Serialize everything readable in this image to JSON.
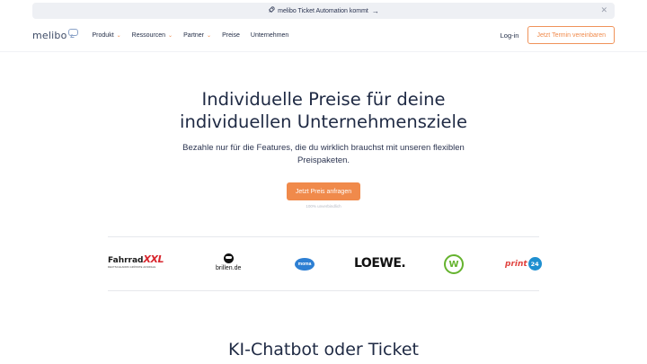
{
  "banner": {
    "icon": "rocket-icon",
    "text": "melibo Ticket Automation kommt",
    "arrow": "→",
    "close": "✕"
  },
  "nav": {
    "logo_text": "melibo",
    "menu": [
      {
        "label": "Produkt",
        "dropdown": true
      },
      {
        "label": "Ressourcen",
        "dropdown": true
      },
      {
        "label": "Partner",
        "dropdown": true
      },
      {
        "label": "Preise",
        "dropdown": false
      },
      {
        "label": "Unternehmen",
        "dropdown": false
      }
    ],
    "chevron": "⌄",
    "login": "Log-in",
    "cta": "Jetzt Termin vereinbaren"
  },
  "hero": {
    "title_line1": "Individuelle Preise für deine",
    "title_line2": "individuellen Unternehmensziele",
    "subtitle_line1": "Bezahle nur für die Features, die du wirklich brauchst mit unseren flexiblen",
    "subtitle_line2": "Preispaketen.",
    "button": "Jetzt Preis anfragen",
    "note": "100% unverbindlich"
  },
  "logos": {
    "fahrrad_a": "Fahrrad",
    "fahrrad_b": "XXL",
    "fahrrad_sub": "DEUTSCHLANDS GRÖSSTE AUSWAHL",
    "brillen": "brillen.de",
    "moma": "moma",
    "loewe": "LOEWE.",
    "vfl": "W",
    "print_a": "print",
    "print_b": "24"
  },
  "section": {
    "title_line1": "KI-Chatbot oder Ticket"
  },
  "colors": {
    "accent": "#f08a4b",
    "text": "#1f2a44",
    "banner_bg": "#eef0f4"
  }
}
